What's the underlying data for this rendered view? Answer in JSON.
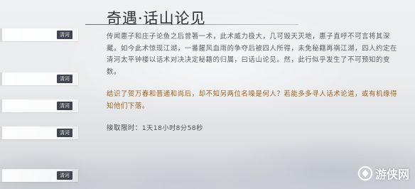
{
  "quest_list": {
    "items": [
      {
        "tag": "清河"
      },
      {
        "tag": "清河"
      },
      {
        "tag": "清河"
      },
      {
        "tag": "清河"
      },
      {
        "tag": "清河"
      }
    ]
  },
  "quest": {
    "title": "奇遇·话山论见",
    "description": "传闻惠子和庄子论鱼之后曾著一术，此术威力极大，几可毁天灭地，惠子直呼不可言将其深藏。如今此术惊现江湖，一番腥风血雨的争夺后被四人所得，未免秘籍再祸江湖，四人约定在清河太平钟楼以话术对决决定秘籍的归属，曰话山论见。然，此行似乎发生了不可预知的变数。",
    "hint": "结识了贺万春和晋通和尚后，却不知另两位名噪是何人？若能多多寻人话术论道，或有机缘得知他们下落。",
    "deadline_label": "接取限时：",
    "deadline_value": "1天18小时8分58秒"
  },
  "watermark": {
    "text": "游侠网",
    "icon": "youxia-logo-icon"
  }
}
